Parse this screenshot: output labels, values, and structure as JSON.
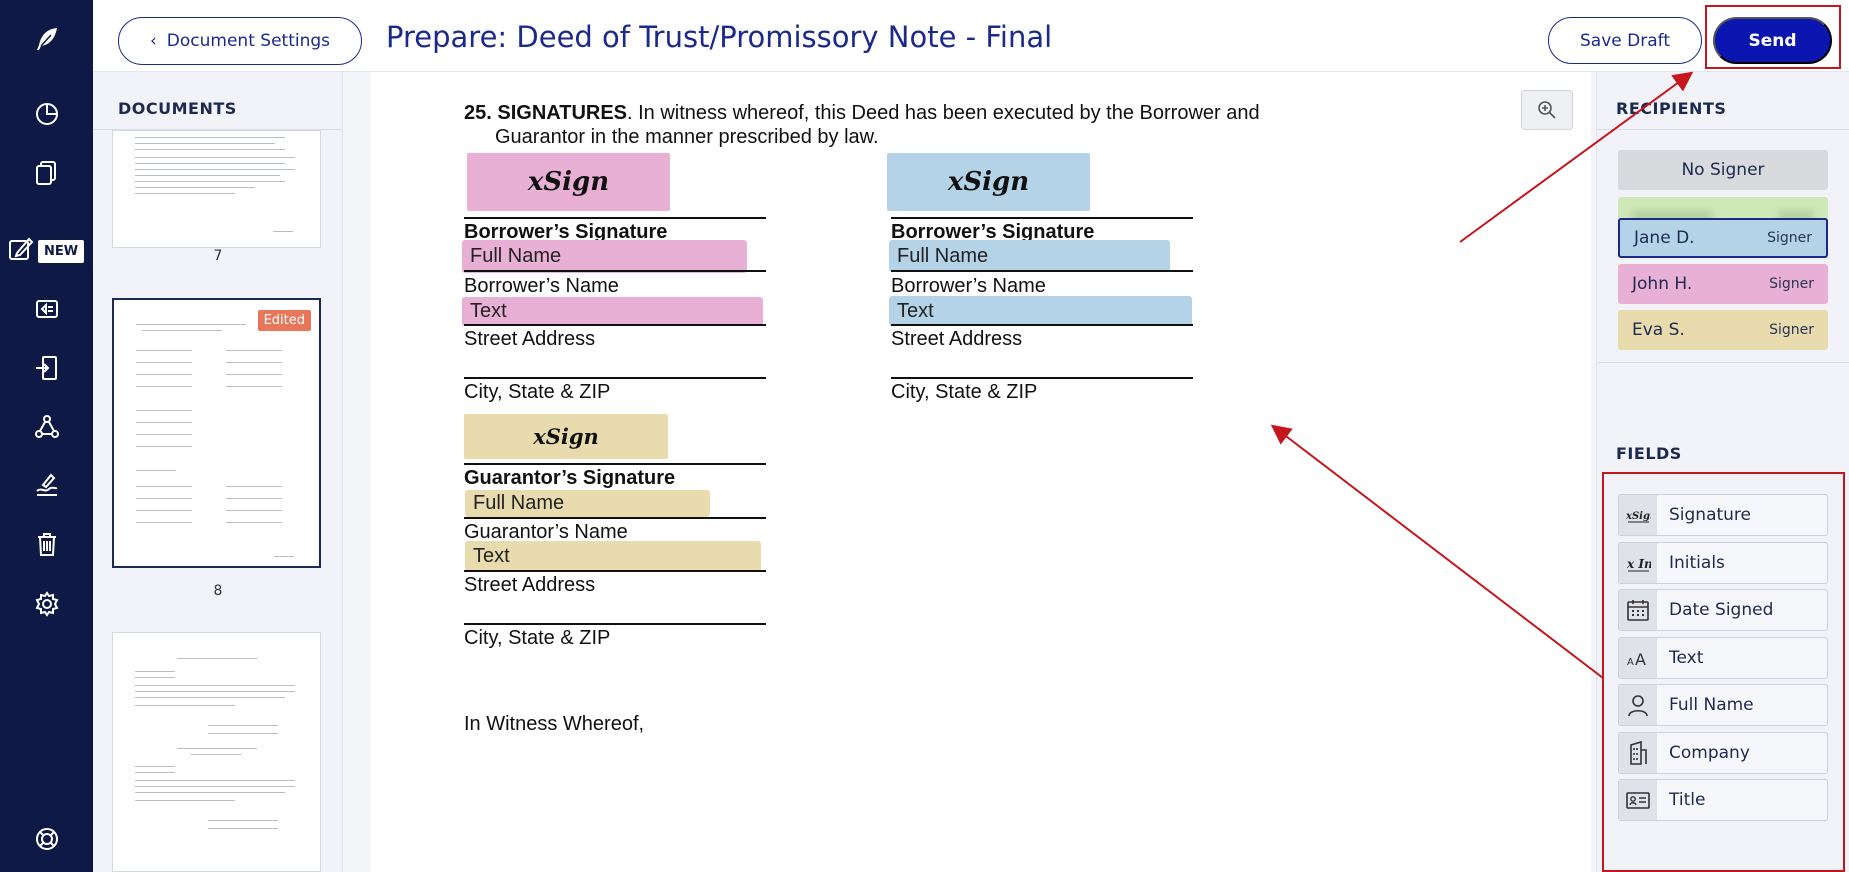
{
  "header": {
    "back_label": "Document Settings",
    "title": "Prepare: Deed of Trust/Promissory Note - Final",
    "save_label": "Save Draft",
    "send_label": "Send"
  },
  "nav": {
    "new_badge": "NEW"
  },
  "documents": {
    "section_title": "DOCUMENTS",
    "thumbnails": [
      {
        "page": "7",
        "edited": false
      },
      {
        "page": "8",
        "edited": true,
        "badge": "Edited"
      },
      {
        "page": "",
        "edited": false
      }
    ]
  },
  "document": {
    "section_number": "25.",
    "section_heading": "SIGNATURES",
    "section_text_1": ". In witness whereof, this Deed has been executed by the Borrower and",
    "section_text_2": "Guarantor in the manner prescribed by law.",
    "sign_mark": "xSign",
    "borrower_sig_label": "Borrower’s Signature",
    "borrower_name_label": "Borrower’s Name",
    "street_label": "Street Address",
    "city_label": "City, State & ZIP",
    "guarantor_sig_label": "Guarantor’s Signature",
    "guarantor_name_label": "Guarantor’s Name",
    "witness_text": "In Witness Whereof,",
    "field_full_name": "Full Name",
    "field_text": "Text"
  },
  "recipients": {
    "section_title": "RECIPIENTS",
    "items": [
      {
        "name": "No Signer",
        "role": "",
        "color": "#d9dadd"
      },
      {
        "name": "",
        "role": "",
        "color": "#cfe8b8"
      },
      {
        "name": "Jane D.",
        "role": "Signer",
        "color": "#b4d3e6"
      },
      {
        "name": "John H.",
        "role": "Signer",
        "color": "#e8b0d4"
      },
      {
        "name": "Eva S.",
        "role": "Signer",
        "color": "#e8dbae"
      }
    ]
  },
  "fields": {
    "section_title": "FIELDS",
    "items": [
      {
        "label": "Signature",
        "icon": "xsign-icon"
      },
      {
        "label": "Initials",
        "icon": "initials-icon"
      },
      {
        "label": "Date Signed",
        "icon": "calendar-icon"
      },
      {
        "label": "Text",
        "icon": "text-size-icon"
      },
      {
        "label": "Full Name",
        "icon": "person-icon"
      },
      {
        "label": "Company",
        "icon": "building-icon"
      },
      {
        "label": "Title",
        "icon": "id-card-icon"
      }
    ]
  },
  "colors": {
    "nav_bg": "#0e1a45",
    "brand_blue": "#1b2a8a",
    "send_bg": "#0b16b0",
    "highlight_red": "#c4161c"
  }
}
